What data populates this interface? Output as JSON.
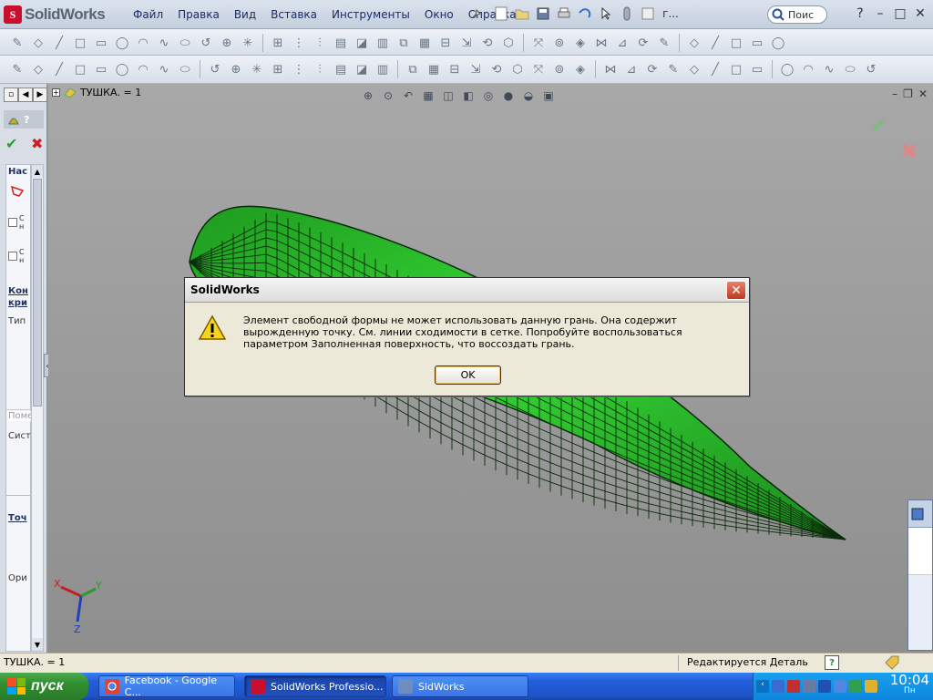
{
  "app": {
    "brand": "SolidWorks"
  },
  "menu": {
    "items": [
      "Файл",
      "Правка",
      "Вид",
      "Вставка",
      "Инструменты",
      "Окно",
      "Справка"
    ]
  },
  "search": {
    "text": "Поис",
    "truncated_label": "г..."
  },
  "feature_tree": {
    "root": "ТУШКА. = 1"
  },
  "left_panel": {
    "lines": [
      "Нас",
      "С н",
      "С н",
      "Кон кри",
      "Тип",
      "Поме",
      "Сист",
      "Точ",
      "Ори"
    ]
  },
  "dialog": {
    "title": "SolidWorks",
    "message": "Элемент свободной формы не может использовать данную грань. Она содержит вырожденную точку. См. линии сходимости в сетке. Попробуйте воспользоваться параметром Заполненная поверхность, что воссоздать грань.",
    "ok_label": "OK",
    "icon": "warning-icon"
  },
  "triad": {
    "x": "X",
    "y": "Y",
    "z": "Z"
  },
  "status": {
    "left": "ТУШКА. = 1",
    "right": "Редактируется Деталь"
  },
  "taskbar": {
    "start_label": "пуск",
    "tasks": [
      "Facebook - Google C...",
      "SolidWorks Professio...",
      "SldWorks"
    ],
    "clock_time": "10:04",
    "clock_day": "Пн"
  },
  "colors": {
    "model_green": "#2fd42f",
    "mesh_line": "#0b2a0b",
    "viewport_bg": "#9c9c9c",
    "title_blue": "#1a2a6b"
  }
}
